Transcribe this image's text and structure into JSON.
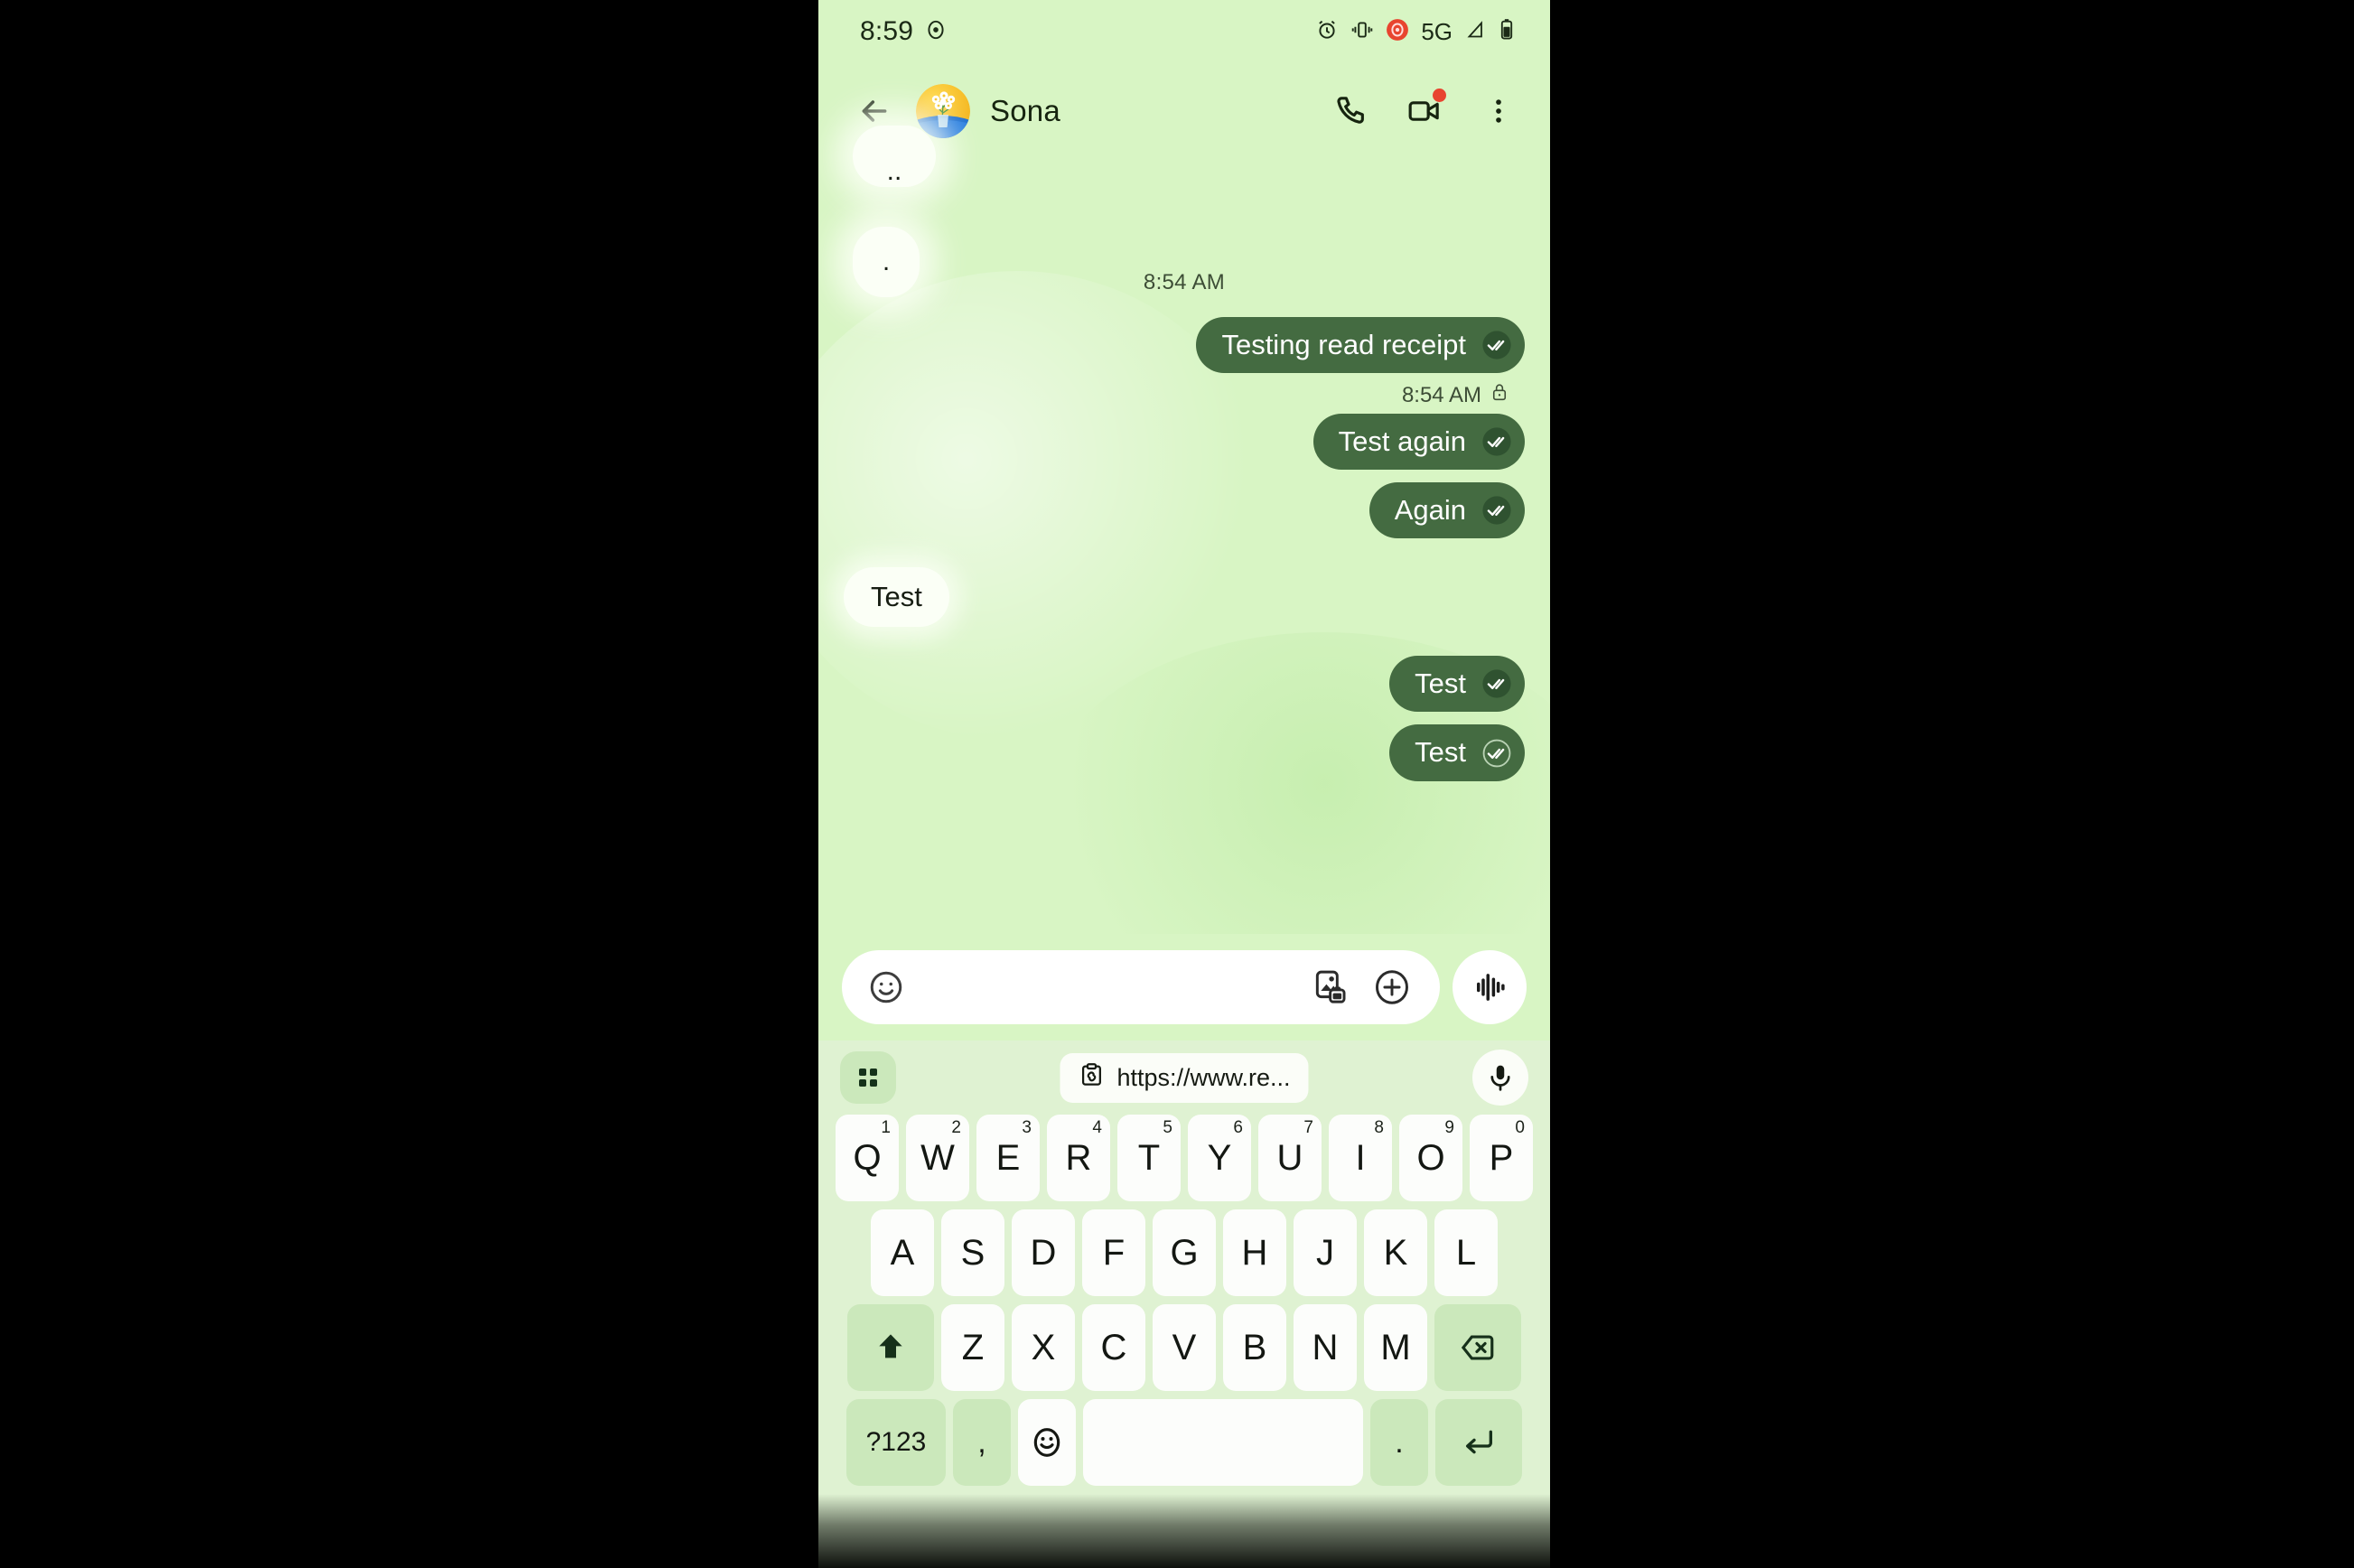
{
  "colors": {
    "screen_bg": "#d8f5c4",
    "bubble_out": "#446b41",
    "bubble_in": "#fbfff6",
    "keyboard_bg": "#dff2d2",
    "key_bg": "#fcfdfb",
    "key_mod_bg": "#cbe8bb",
    "badge_red": "#e8442f"
  },
  "status_bar": {
    "time": "8:59",
    "left_icons": [
      "screen-record-icon"
    ],
    "right_icons": [
      "alarm-icon",
      "vibrate-icon",
      "recording-icon",
      "signal-icon",
      "battery-icon"
    ],
    "network": "5G"
  },
  "app_bar": {
    "back_label": "Back",
    "contact_name": "Sona",
    "avatar_alt": "flowers-in-vase-avatar",
    "actions": [
      {
        "name": "call-button",
        "label": "Call"
      },
      {
        "name": "video-call-button",
        "label": "Video call",
        "badge": true
      },
      {
        "name": "more-options-button",
        "label": "More options"
      }
    ]
  },
  "conversation": {
    "partial_messages": [
      {
        "text": "..",
        "direction": "in"
      },
      {
        "text": ".",
        "direction": "in"
      }
    ],
    "day_stamp": "8:54 AM",
    "messages": [
      {
        "text": "Testing read receipt",
        "direction": "out",
        "receipt": "read"
      },
      {
        "stamp": "8:54 AM",
        "encrypted": true
      },
      {
        "text": "Test again",
        "direction": "out",
        "receipt": "read"
      },
      {
        "text": "Again",
        "direction": "out",
        "receipt": "read"
      },
      {
        "text": "Test",
        "direction": "in"
      },
      {
        "text": "Test",
        "direction": "out",
        "receipt": "read"
      },
      {
        "text": "Test",
        "direction": "out",
        "receipt": "delivered"
      }
    ]
  },
  "compose": {
    "placeholder": "",
    "value": "",
    "emoji_button": "emoji-icon",
    "gallery_button": "gallery-camera-icon",
    "plus_button": "add-attachment-icon",
    "voice_button": "audio-waveform-icon"
  },
  "keyboard": {
    "suggestion_strip": {
      "grid_button": "app-grid-icon",
      "clipboard_suggestion": "https://www.re...",
      "mic_button": "voice-input-icon"
    },
    "row1": [
      {
        "key": "Q",
        "num": "1"
      },
      {
        "key": "W",
        "num": "2"
      },
      {
        "key": "E",
        "num": "3"
      },
      {
        "key": "R",
        "num": "4"
      },
      {
        "key": "T",
        "num": "5"
      },
      {
        "key": "Y",
        "num": "6"
      },
      {
        "key": "U",
        "num": "7"
      },
      {
        "key": "I",
        "num": "8"
      },
      {
        "key": "O",
        "num": "9"
      },
      {
        "key": "P",
        "num": "0"
      }
    ],
    "row2": [
      {
        "key": "A"
      },
      {
        "key": "S"
      },
      {
        "key": "D"
      },
      {
        "key": "F"
      },
      {
        "key": "G"
      },
      {
        "key": "H"
      },
      {
        "key": "J"
      },
      {
        "key": "K"
      },
      {
        "key": "L"
      }
    ],
    "row3": [
      {
        "key": "Z"
      },
      {
        "key": "X"
      },
      {
        "key": "C"
      },
      {
        "key": "V"
      },
      {
        "key": "B"
      },
      {
        "key": "N"
      },
      {
        "key": "M"
      }
    ],
    "shift_label": "shift-icon",
    "backspace_label": "backspace-icon",
    "sym_label": "?123",
    "comma_label": ",",
    "emoji_label": "emoji-icon",
    "space_label": "",
    "period_label": ".",
    "enter_label": "enter-icon"
  }
}
